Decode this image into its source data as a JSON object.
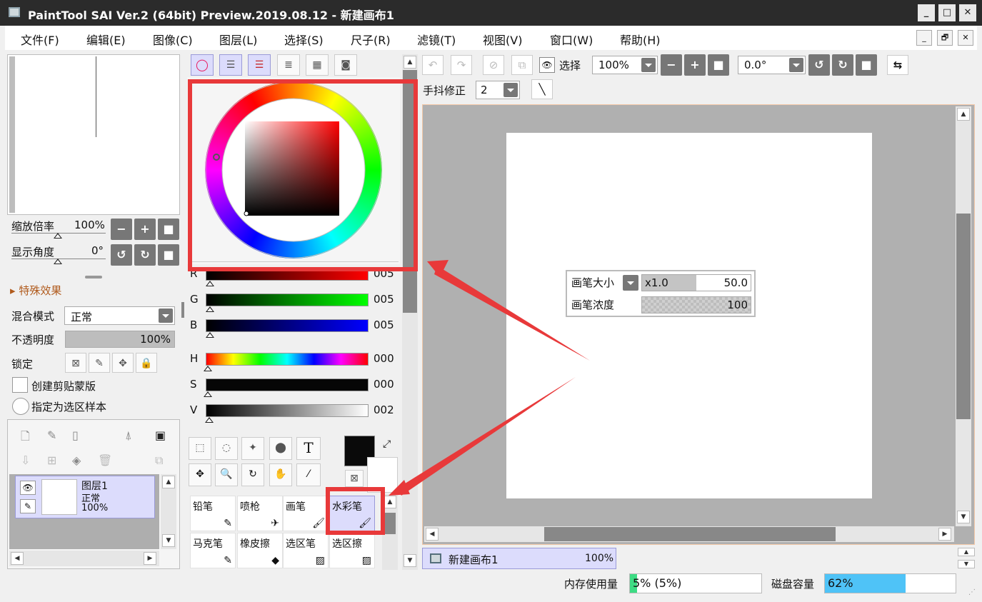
{
  "window": {
    "title": "PaintTool SAI Ver.2 (64bit) Preview.2019.08.12 - 新建画布1",
    "min": "_",
    "max": "□",
    "close": "✕"
  },
  "menu": [
    "文件(F)",
    "编辑(E)",
    "图像(C)",
    "图层(L)",
    "选择(S)",
    "尺子(R)",
    "滤镜(T)",
    "视图(V)",
    "窗口(W)",
    "帮助(H)"
  ],
  "mdi": {
    "min": "_",
    "restore": "🗗",
    "close": "✕"
  },
  "navigator": {
    "zoom_label": "缩放倍率",
    "zoom_value": "100%",
    "angle_label": "显示角度",
    "angle_value": "0°"
  },
  "layer_props": {
    "effects": "特殊效果",
    "blend_label": "混合模式",
    "blend_value": "正常",
    "opacity_label": "不透明度",
    "opacity_value": "100%",
    "opacity": 1.0,
    "lock_label": "锁定",
    "clip": "创建剪贴蒙版",
    "sample": "指定为选区样本"
  },
  "layer": {
    "name": "图层1",
    "mode": "正常",
    "opacity": "100%"
  },
  "color": {
    "R": {
      "label": "R",
      "value": "005"
    },
    "G": {
      "label": "G",
      "value": "005"
    },
    "B": {
      "label": "B",
      "value": "005"
    },
    "H": {
      "label": "H",
      "value": "000"
    },
    "S": {
      "label": "S",
      "value": "000"
    },
    "V": {
      "label": "V",
      "value": "002"
    },
    "primary": "#0a0a0a"
  },
  "tools": [
    "铅笔",
    "喷枪",
    "画笔",
    "水彩笔",
    "马克笔",
    "橡皮擦",
    "选区笔",
    "选区擦"
  ],
  "canvas_toolbar": {
    "select_label": "选择",
    "zoom_value": "100%",
    "angle_value": "0.0°",
    "stab_label": "手抖修正",
    "stab_value": "2"
  },
  "brush_popup": {
    "size_label": "画笔大小",
    "size_mult": "x1.0",
    "size_value": "50.0",
    "density_label": "画笔浓度",
    "density_value": "100"
  },
  "doc_tab": {
    "name": "新建画布1",
    "zoom": "100%"
  },
  "status": {
    "mem_label": "内存使用量",
    "mem_value": "5% (5%)",
    "mem_fill": 0.05,
    "disk_label": "磁盘容量",
    "disk_value": "62%",
    "disk_fill": 0.62
  },
  "colors": {
    "annotation": "#e8393a",
    "selected": "#dcdcfc",
    "accent_bar": "#4fc3f7"
  }
}
